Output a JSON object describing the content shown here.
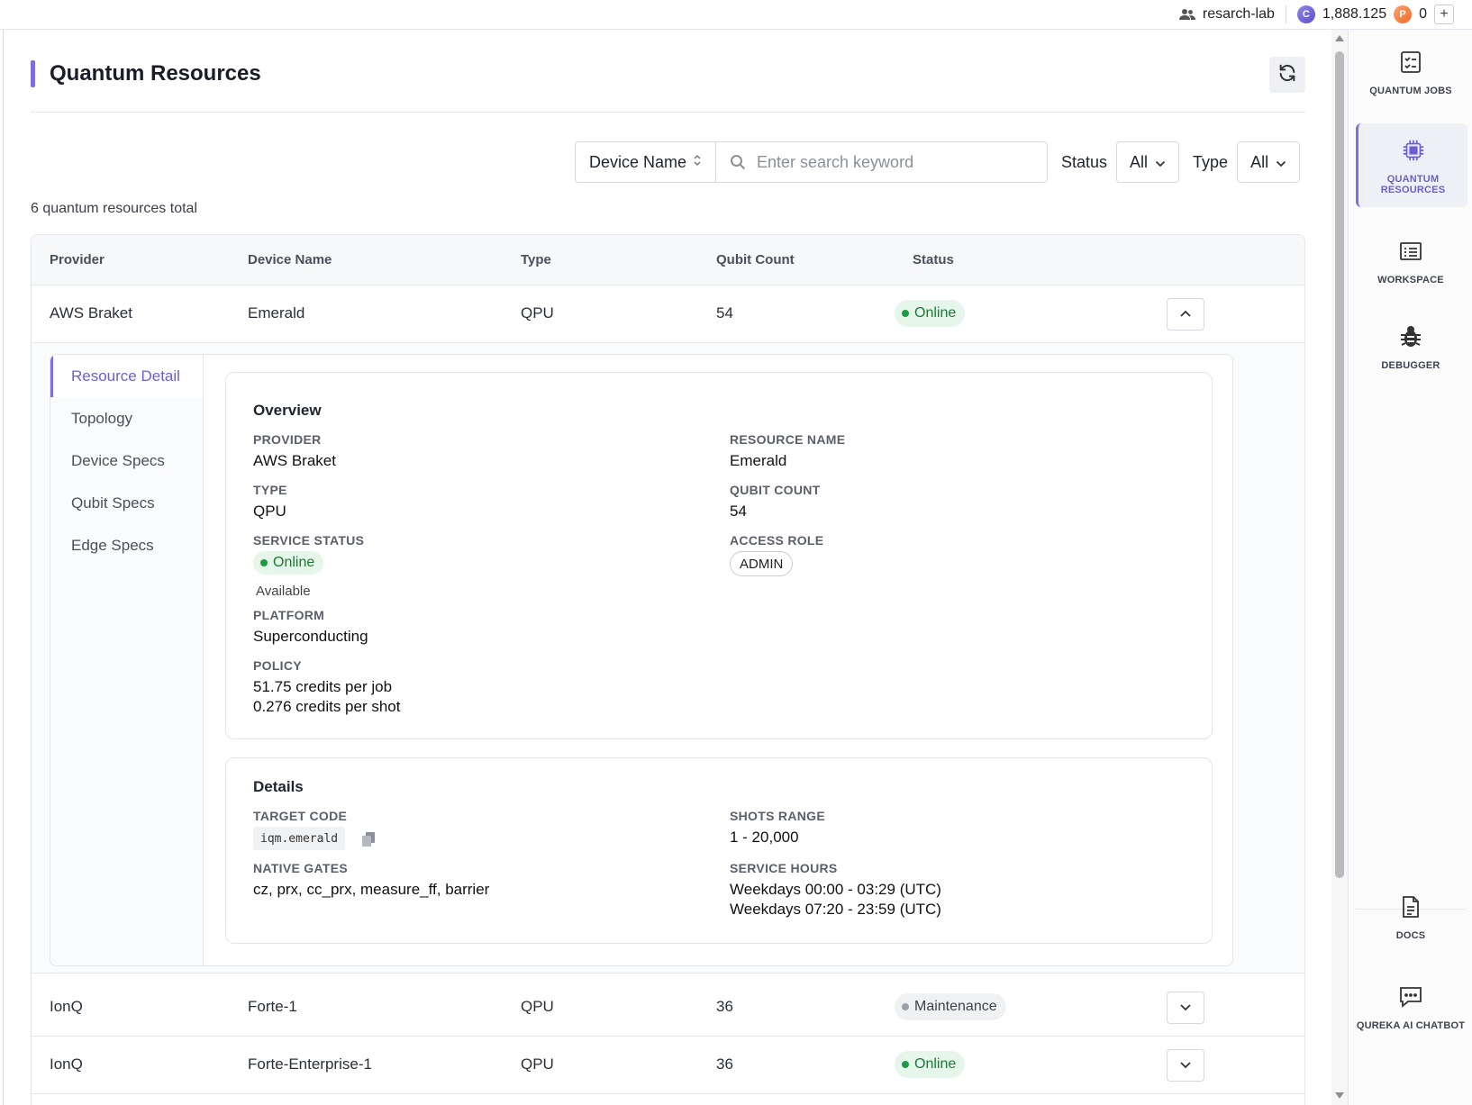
{
  "topbar": {
    "org": "resarch-lab",
    "credits": "1,888.125",
    "credit_icon": "C",
    "points": "0",
    "points_icon": "P",
    "add": "+"
  },
  "page": {
    "title": "Quantum Resources",
    "total_text": "6 quantum resources total"
  },
  "filters": {
    "field_select": "Device Name",
    "search_placeholder": "Enter search keyword",
    "status_label": "Status",
    "status_value": "All",
    "type_label": "Type",
    "type_value": "All"
  },
  "table": {
    "headers": [
      "Provider",
      "Device Name",
      "Type",
      "Qubit Count",
      "Status"
    ],
    "rows": [
      {
        "provider": "AWS Braket",
        "device": "Emerald",
        "type": "QPU",
        "qubits": "54",
        "status": "Online"
      },
      {
        "provider": "IonQ",
        "device": "Forte-1",
        "type": "QPU",
        "qubits": "36",
        "status": "Maintenance"
      },
      {
        "provider": "IonQ",
        "device": "Forte-Enterprise-1",
        "type": "QPU",
        "qubits": "36",
        "status": "Online"
      }
    ]
  },
  "detail": {
    "nav": [
      "Resource Detail",
      "Topology",
      "Device Specs",
      "Qubit Specs",
      "Edge Specs"
    ],
    "overview": {
      "title": "Overview",
      "provider_label": "PROVIDER",
      "provider": "AWS Braket",
      "resource_name_label": "RESOURCE NAME",
      "resource_name": "Emerald",
      "type_label": "TYPE",
      "type": "QPU",
      "qubit_count_label": "QUBIT COUNT",
      "qubit_count": "54",
      "service_status_label": "SERVICE STATUS",
      "service_status": "Online",
      "service_status_sub": "Available",
      "access_role_label": "ACCESS ROLE",
      "access_role": "ADMIN",
      "platform_label": "PLATFORM",
      "platform": "Superconducting",
      "policy_label": "POLICY",
      "policy_line1": "51.75 credits per job",
      "policy_line2": "0.276 credits per shot"
    },
    "details": {
      "title": "Details",
      "target_code_label": "TARGET CODE",
      "target_code": "iqm.emerald",
      "shots_range_label": "SHOTS RANGE",
      "shots_range": "1 - 20,000",
      "native_gates_label": "NATIVE GATES",
      "native_gates": "cz, prx, cc_prx, measure_ff, barrier",
      "service_hours_label": "SERVICE HOURS",
      "service_hours_1": "Weekdays 00:00 - 03:29 (UTC)",
      "service_hours_2": "Weekdays 07:20 - 23:59 (UTC)"
    }
  },
  "sidebar": {
    "items": [
      {
        "label": "QUANTUM JOBS",
        "icon": "checklist-icon"
      },
      {
        "label": "QUANTUM RESOURCES",
        "icon": "chip-icon"
      },
      {
        "label": "WORKSPACE",
        "icon": "workspace-icon"
      },
      {
        "label": "DEBUGGER",
        "icon": "bug-icon"
      },
      {
        "label": "DOCS",
        "icon": "document-icon"
      },
      {
        "label": "QUREKA AI CHATBOT",
        "icon": "chat-icon"
      }
    ]
  },
  "colors": {
    "accent": "#7b6fe0",
    "online": "#1f9a43",
    "maintenance": "#9aa0aa"
  }
}
